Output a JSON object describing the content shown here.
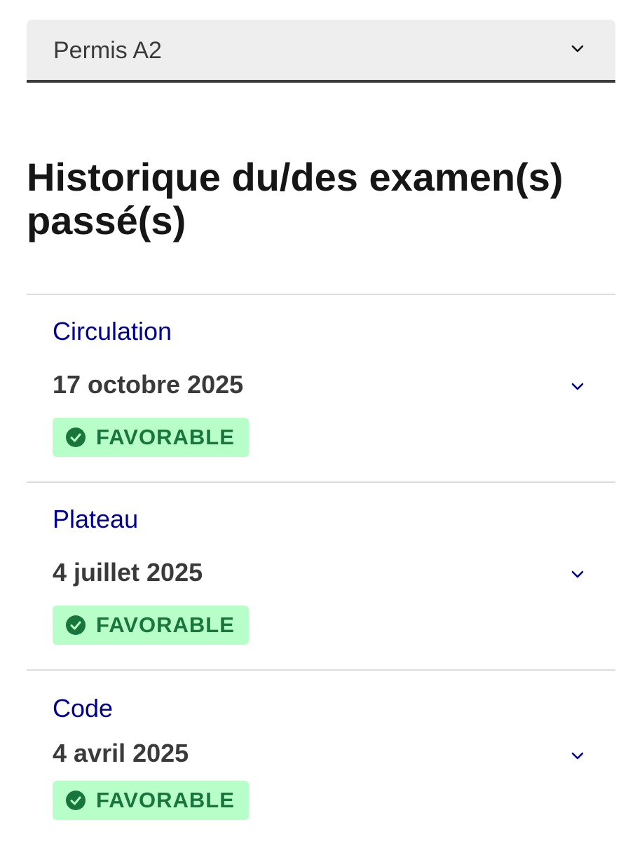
{
  "licence_select": {
    "value": "Permis A2",
    "icon": "chevron-down-icon"
  },
  "history": {
    "title": "Historique du/des examen(s) passé(s)",
    "exams": [
      {
        "name": "Circulation",
        "date": "17 octobre 2025",
        "status": "FAVORABLE"
      },
      {
        "name": "Plateau",
        "date": "4 juillet 2025",
        "status": "FAVORABLE"
      },
      {
        "name": "Code",
        "date": "4 avril 2025",
        "status": "FAVORABLE"
      }
    ]
  },
  "colors": {
    "link_blue": "#000091",
    "success_text": "#18753c",
    "success_bg": "#b8fec9",
    "select_bg": "#eeeeee"
  }
}
